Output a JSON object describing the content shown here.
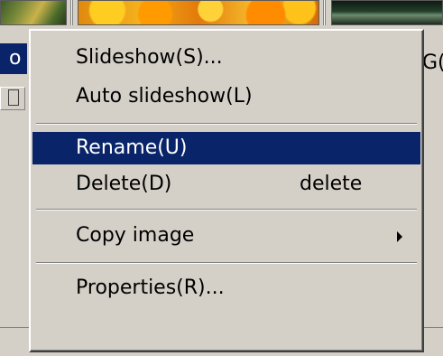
{
  "background": {
    "left_row_text": "o",
    "right_row_text": "G("
  },
  "context_menu": {
    "items": [
      {
        "label": "Slideshow(S)...",
        "shortcut": "",
        "highlighted": false,
        "has_submenu": false
      },
      {
        "label": "Auto slideshow(L)",
        "shortcut": "",
        "highlighted": false,
        "has_submenu": false
      },
      {
        "label": "Rename(U)",
        "shortcut": "",
        "highlighted": true,
        "has_submenu": false
      },
      {
        "label": "Delete(D)",
        "shortcut": "delete",
        "highlighted": false,
        "has_submenu": false
      },
      {
        "label": "Copy image",
        "shortcut": "",
        "highlighted": false,
        "has_submenu": true
      },
      {
        "label": "Properties(R)...",
        "shortcut": "",
        "highlighted": false,
        "has_submenu": false
      }
    ]
  },
  "colors": {
    "menu_background": "#d4d0c8",
    "highlight": "#0a246a",
    "highlight_text": "#ffffff",
    "text": "#000000"
  }
}
